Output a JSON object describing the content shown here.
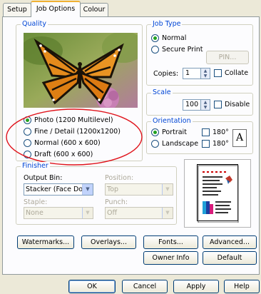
{
  "tabs": [
    {
      "label": "Setup"
    },
    {
      "label": "Job Options"
    },
    {
      "label": "Colour"
    }
  ],
  "quality": {
    "legend": "Quality",
    "options": [
      {
        "label": "Photo (1200 Multilevel)",
        "selected": true
      },
      {
        "label": "Fine / Detail (1200x1200)",
        "selected": false
      },
      {
        "label": "Normal (600 x 600)",
        "selected": false
      },
      {
        "label": "Draft (600 x 600)",
        "selected": false
      }
    ]
  },
  "job_type": {
    "legend": "Job Type",
    "normal_label": "Normal",
    "secure_label": "Secure Print",
    "pin_label": "PIN...",
    "copies_label": "Copies:",
    "copies_value": "1",
    "collate_label": "Collate"
  },
  "scale": {
    "legend": "Scale",
    "value": "100",
    "disable_label": "Disable"
  },
  "orientation": {
    "legend": "Orientation",
    "portrait_label": "Portrait",
    "landscape_label": "Landscape",
    "rotate1_label": "180°",
    "rotate2_label": "180°",
    "preview_letter": "A"
  },
  "finisher": {
    "legend": "Finisher",
    "output_bin_label": "Output Bin:",
    "output_bin_value": "Stacker (Face Down)",
    "position_label": "Position:",
    "position_value": "Top",
    "staple_label": "Staple:",
    "staple_value": "None",
    "punch_label": "Punch:",
    "punch_value": "Off"
  },
  "buttons": {
    "watermarks": "Watermarks...",
    "overlays": "Overlays...",
    "fonts": "Fonts...",
    "advanced": "Advanced...",
    "owner_info": "Owner Info",
    "default": "Default"
  },
  "dialog": {
    "ok": "OK",
    "cancel": "Cancel",
    "apply": "Apply",
    "help": "Help"
  },
  "colors": {
    "legend_blue": "#0046d5",
    "highlight_ellipse": "#e0141c",
    "active_tab_accent": "#f0b133",
    "radio_dot": "#21a121"
  }
}
